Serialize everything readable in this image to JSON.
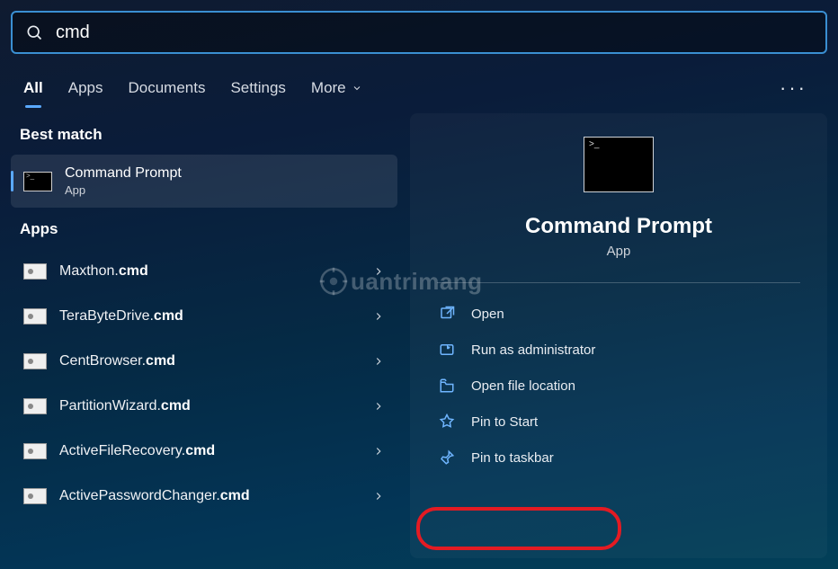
{
  "search": {
    "query": "cmd"
  },
  "tabs": {
    "items": [
      "All",
      "Apps",
      "Documents",
      "Settings",
      "More"
    ],
    "active_index": 0
  },
  "sections": {
    "best_match": "Best match",
    "apps": "Apps"
  },
  "best_match": {
    "title": "Command Prompt",
    "subtitle": "App"
  },
  "apps": [
    {
      "prefix": "Maxthon.",
      "bold": "cmd"
    },
    {
      "prefix": "TeraByteDrive.",
      "bold": "cmd"
    },
    {
      "prefix": "CentBrowser.",
      "bold": "cmd"
    },
    {
      "prefix": "PartitionWizard.",
      "bold": "cmd"
    },
    {
      "prefix": "ActiveFileRecovery.",
      "bold": "cmd"
    },
    {
      "prefix": "ActivePasswordChanger.",
      "bold": "cmd"
    }
  ],
  "panel": {
    "title": "Command Prompt",
    "subtitle": "App",
    "actions": [
      {
        "icon": "open",
        "label": "Open"
      },
      {
        "icon": "admin",
        "label": "Run as administrator"
      },
      {
        "icon": "folder",
        "label": "Open file location"
      },
      {
        "icon": "pinstart",
        "label": "Pin to Start"
      },
      {
        "icon": "pintask",
        "label": "Pin to taskbar"
      }
    ]
  },
  "watermark": "uantrimang"
}
